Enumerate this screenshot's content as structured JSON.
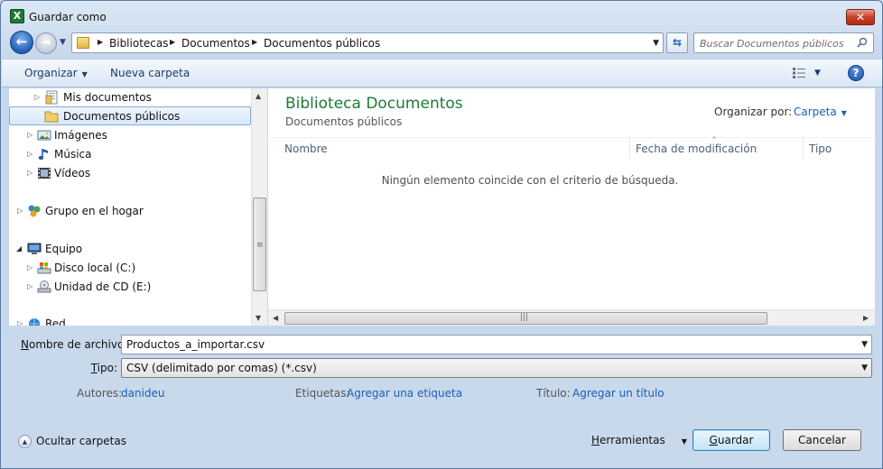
{
  "window": {
    "title": "Guardar como",
    "app_icon_letter": "X",
    "close_glyph": "✕"
  },
  "navigation": {
    "back_glyph": "←",
    "forward_glyph": "→",
    "breadcrumb": [
      "Bibliotecas",
      "Documentos",
      "Documentos públicos"
    ],
    "search_placeholder": "Buscar Documentos públicos"
  },
  "toolbar": {
    "organize_label": "Organizar",
    "new_folder_label": "Nueva carpeta",
    "help_glyph": "?"
  },
  "nav_pane": {
    "items": [
      {
        "label": "Mis documentos",
        "icon": "documents-folder-icon"
      },
      {
        "label": "Documentos públicos",
        "icon": "folder-icon",
        "selected": true
      },
      {
        "label": "Imágenes",
        "icon": "pictures-icon"
      },
      {
        "label": "Música",
        "icon": "music-icon"
      },
      {
        "label": "Vídeos",
        "icon": "videos-icon"
      },
      {
        "label": "Grupo en el hogar",
        "icon": "homegroup-icon"
      },
      {
        "label": "Equipo",
        "icon": "computer-icon"
      },
      {
        "label": "Disco local (C:)",
        "icon": "hard-drive-icon"
      },
      {
        "label": "Unidad de CD (E:)",
        "icon": "cd-drive-icon"
      },
      {
        "label": "Red",
        "icon": "network-icon"
      }
    ]
  },
  "content": {
    "library_title": "Biblioteca Documentos",
    "library_subtitle": "Documentos públicos",
    "arrange_label": "Organizar por:",
    "arrange_value": "Carpeta",
    "columns": [
      "Nombre",
      "Fecha de modificación",
      "Tipo"
    ],
    "empty_message": "Ningún elemento coincide con el criterio de búsqueda."
  },
  "form": {
    "filename_label_access": "N",
    "filename_label_rest": "ombre de archivo:",
    "filename_value": "Productos_a_importar.csv",
    "type_label_access": "T",
    "type_label_rest": "ipo:",
    "type_value": "CSV (delimitado por comas) (*.csv)",
    "authors_label": "Autores:",
    "authors_value": "danideu",
    "tags_label": "Etiquetas:",
    "tags_value": "Agregar una etiqueta",
    "title_label": "Título:",
    "title_value": "Agregar un título"
  },
  "footer": {
    "hide_folders_label": "Ocultar carpetas",
    "tools_access": "H",
    "tools_rest": "erramientas",
    "save_access": "G",
    "save_rest": "uardar",
    "cancel_label": "Cancelar"
  },
  "colors": {
    "library_title": "#1d7a35",
    "link": "#1b5fb5",
    "selection": "#d8e8fb"
  }
}
